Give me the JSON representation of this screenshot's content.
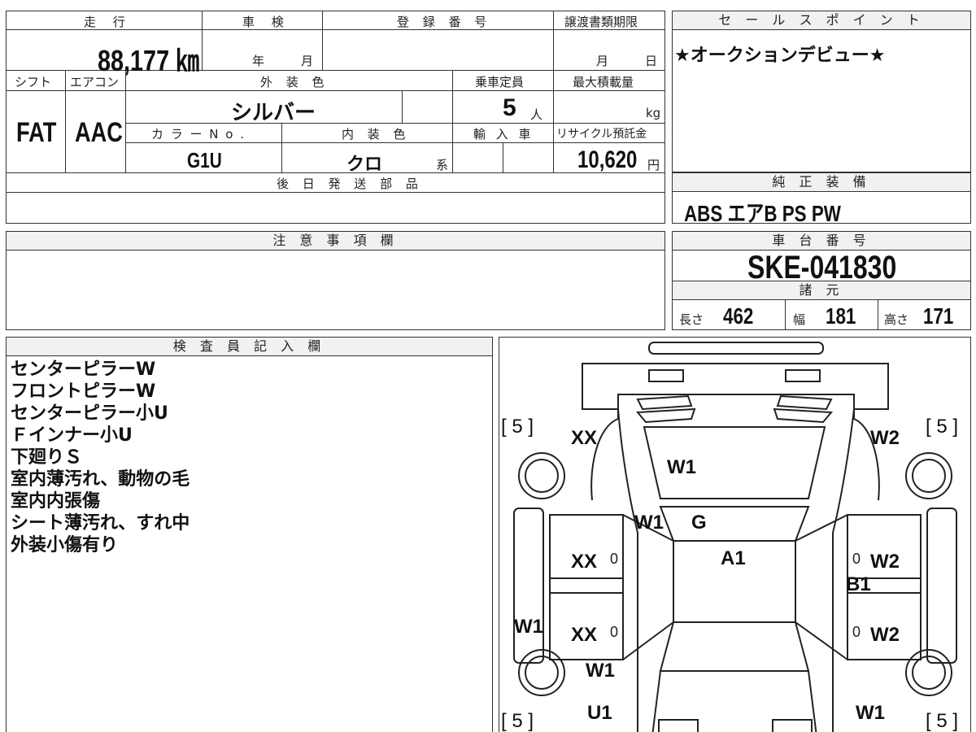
{
  "main": {
    "mileage_label": "走 行",
    "mileage": "88,177 ㎞",
    "shaken_label": "車 検",
    "shaken_year": "年",
    "shaken_month": "月",
    "reg_label": "登 録 番 号",
    "transfer_label": "譲渡書類期限",
    "transfer_month": "月",
    "transfer_day": "日",
    "shift_label": "シフト",
    "shift": "FAT",
    "ac_label": "エアコン",
    "ac": "AAC",
    "ext_color_label": "外 装 色",
    "ext_color": "シルバー",
    "capacity_label": "乗車定員",
    "capacity": "5",
    "capacity_unit": "人",
    "maxload_label": "最大積載量",
    "maxload_unit": "kg",
    "color_no_label": "カ ラ ー N o .",
    "color_no": "G1U",
    "int_color_label": "内 装 色",
    "int_color": "クロ",
    "int_color_suffix": "系",
    "import_label": "輸 入 車",
    "recycle_label": "リサイクル預託金",
    "recycle": "10,620",
    "recycle_unit": "円",
    "later_parts_label": "後 日 発 送 部 品"
  },
  "sales": {
    "label": "セ ー ル ス ポ イ ン ト",
    "text": "★オークションデビュー★"
  },
  "equipment": {
    "label": "純 正 装 備",
    "text": "ABS  エアB  PS  PW"
  },
  "caution": {
    "label": "注 意 事 項 欄"
  },
  "chassis": {
    "label": "車 台 番 号",
    "number": "SKE-041830"
  },
  "specs": {
    "label": "諸 元",
    "length_label": "長さ",
    "length": "462",
    "width_label": "幅",
    "width": "181",
    "height_label": "高さ",
    "height": "171"
  },
  "inspector": {
    "label": "検 査 員 記 入 欄",
    "lines": [
      "センターピラーW",
      "フロントピラーW",
      "センターピラー小U",
      "Ｆインナー小U",
      "下廻りＳ",
      "室内薄汚れ、動物の毛",
      "室内内張傷",
      "シート薄汚れ、すれ中",
      "外装小傷有り"
    ]
  },
  "diagram": {
    "tire_fl": "[ 5 ]",
    "tire_fr": "[ 5 ]",
    "tire_rl": "[ 5 ]",
    "tire_rr": "[ 5 ]",
    "zero": "0",
    "marks": {
      "fl_fender": "XX",
      "hood": "W1",
      "fr_fender": "W2",
      "l_pillar": "W1",
      "windshield": "G",
      "roof": "A1",
      "l_front_door": "XX",
      "r_front_door": "W2",
      "r_center_pillar": "B1",
      "l_rocker": "W1",
      "l_rear_door": "XX",
      "r_rear_door": "W2",
      "l_quarter": "W1",
      "l_rear": "U1",
      "r_rear": "W1"
    }
  }
}
